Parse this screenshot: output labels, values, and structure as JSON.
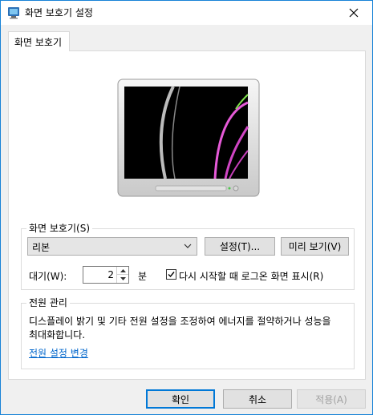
{
  "window": {
    "title": "화면 보호기 설정",
    "close_icon": "close-icon"
  },
  "tab": {
    "label": "화면 보호기"
  },
  "screensaver_group": {
    "label": "화면 보호기(S)",
    "selected": "리본",
    "settings_button": "설정(T)...",
    "preview_button": "미리 보기(V)",
    "wait_label": "대기(W):",
    "wait_value": "2",
    "minutes_label": "분",
    "resume_logon_checked": true,
    "resume_logon_label": "다시 시작할 때 로그온 화면 표시(R)"
  },
  "power_group": {
    "label": "전원 관리",
    "description": "디스플레이 밝기 및 기타 전원 설정을 조정하여 에너지를 절약하거나 성능을 최대화합니다.",
    "link": "전원 설정 변경"
  },
  "footer": {
    "ok": "확인",
    "cancel": "취소",
    "apply": "적용(A)"
  }
}
